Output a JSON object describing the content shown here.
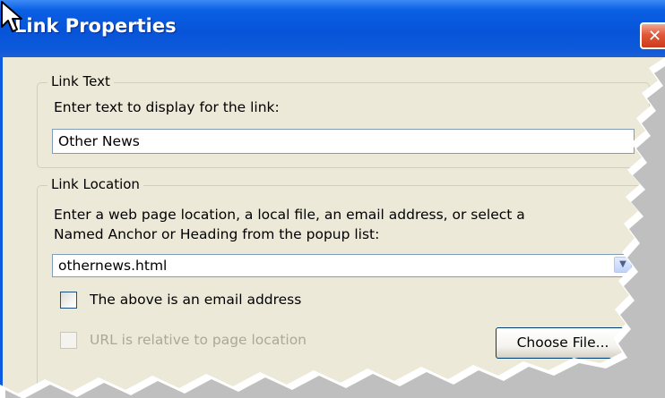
{
  "window": {
    "title": "Link Properties",
    "close_glyph": "✕"
  },
  "link_text_group": {
    "legend": "Link Text",
    "prompt": "Enter text to display for the link:",
    "value": "Other News"
  },
  "link_location_group": {
    "legend": "Link Location",
    "prompt_line1": "Enter a web page location, a local file, an email address, or select a",
    "prompt_line2": "Named Anchor or Heading from the popup list:",
    "value": "othernews.html",
    "email_checkbox_label": "The above is an email address",
    "email_checkbox_checked": false,
    "relative_checkbox_label": "URL is relative to page location",
    "relative_checkbox_enabled": false,
    "choose_file_label": "Choose File..."
  },
  "colors": {
    "titlebar": "#0754d9",
    "dialog_bg": "#ece9d8",
    "close_button": "#e2583a"
  }
}
